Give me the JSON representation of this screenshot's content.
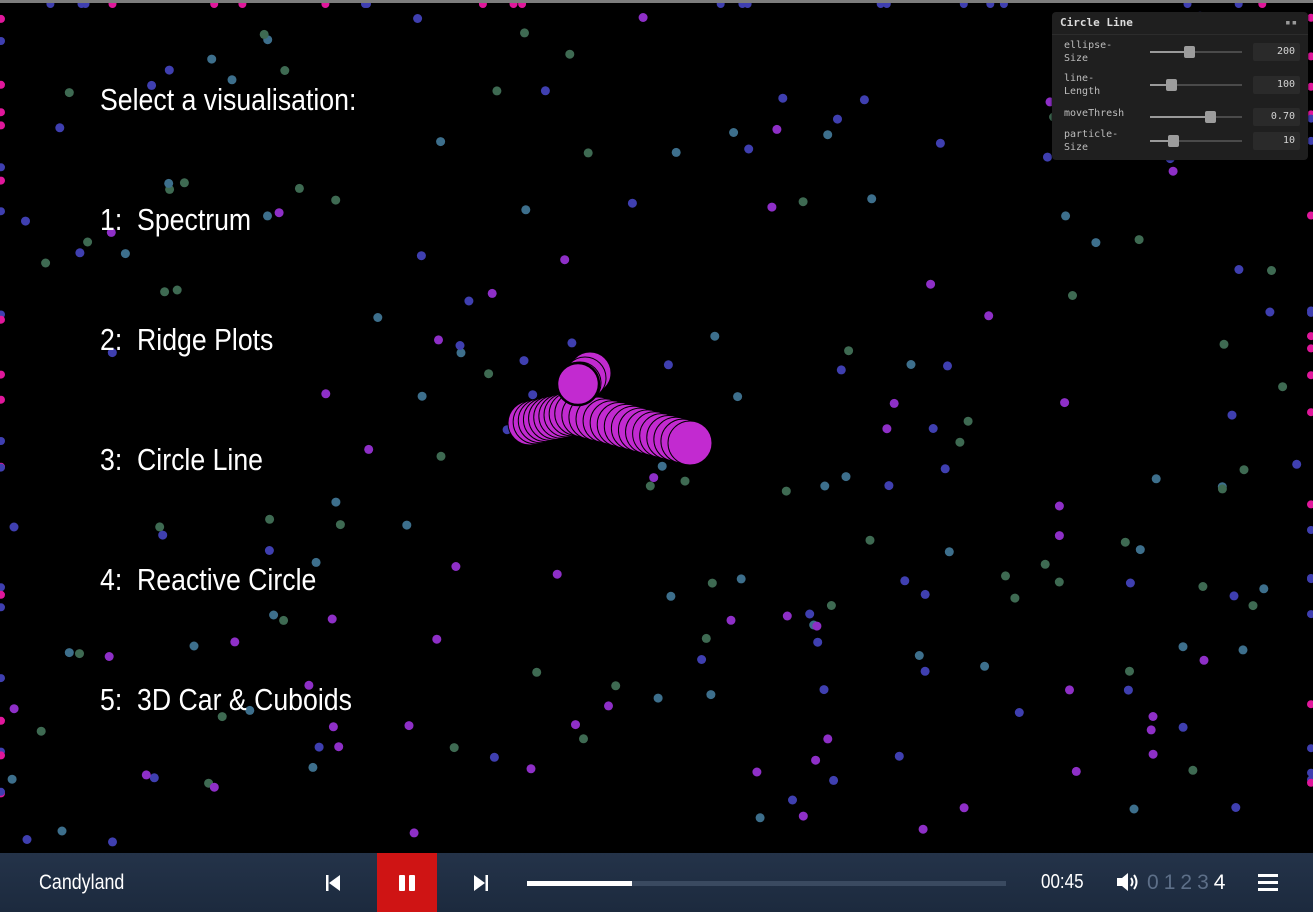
{
  "menu": {
    "heading": "Select a visualisation:",
    "items": [
      "1:  Spectrum",
      "2:  Ridge Plots",
      "3:  Circle Line",
      "4:  Reactive Circle",
      "5:  3D Car & Cuboids"
    ]
  },
  "gui": {
    "title": "Circle Line",
    "controls": [
      {
        "label_a": "ellipse-",
        "label_b": "Size",
        "value": "200",
        "level": 0.42
      },
      {
        "label_a": "line-",
        "label_b": "Length",
        "value": "100",
        "level": 0.23
      },
      {
        "label_a": "moveThresh",
        "label_b": "",
        "value": "0.70",
        "level": 0.65
      },
      {
        "label_a": "particle-",
        "label_b": "Size",
        "value": "10",
        "level": 0.25
      }
    ]
  },
  "player": {
    "track_title": "Candyland",
    "time": "00:45",
    "progress": 0.22,
    "volume_levels": [
      "0",
      "1",
      "2",
      "3",
      "4"
    ],
    "volume_selected": 4,
    "icons": {
      "prev": "skip-back-icon",
      "pause": "pause-icon",
      "next": "skip-forward-icon",
      "volume": "speaker-icon",
      "menu": "hamburger-menu-icon"
    }
  },
  "colors": {
    "accent_red": "#cf1414",
    "circle_magenta": "#c22ad0",
    "particles": [
      "#3f3fb0",
      "#3d6f8c",
      "#3e6a52",
      "#8e2fc7",
      "#e0179b"
    ]
  }
}
